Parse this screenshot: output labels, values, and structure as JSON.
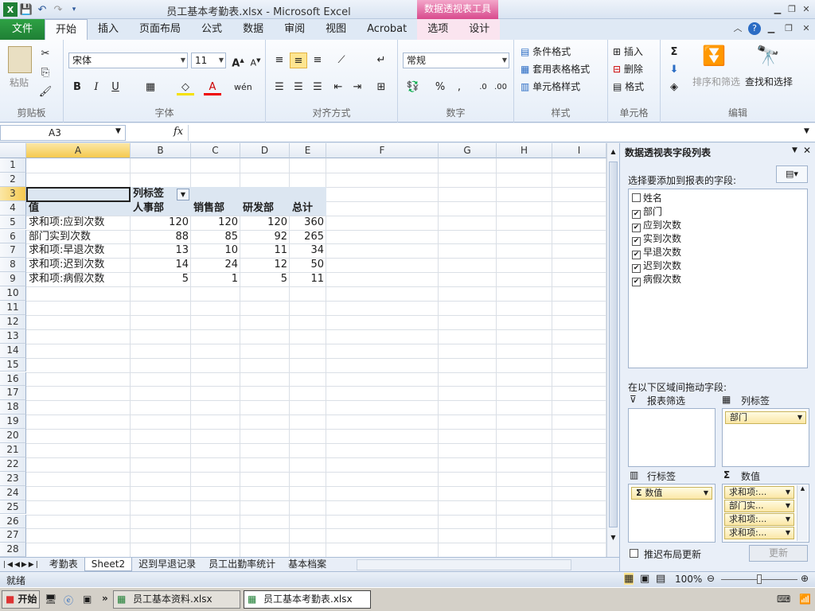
{
  "window": {
    "title": "员工基本考勤表.xlsx - Microsoft Excel",
    "pivot_tools": "数据透视表工具"
  },
  "tabs": [
    "文件",
    "开始",
    "插入",
    "页面布局",
    "公式",
    "数据",
    "审阅",
    "视图",
    "Acrobat",
    "选项",
    "设计"
  ],
  "ribbon": {
    "clipboard": {
      "paste": "粘贴",
      "label": "剪贴板"
    },
    "font": {
      "name": "宋体",
      "size": "11",
      "label": "字体"
    },
    "align": {
      "label": "对齐方式"
    },
    "number": {
      "format": "常规",
      "label": "数字"
    },
    "styles": {
      "cond": "条件格式",
      "table": "套用表格格式",
      "cell": "单元格样式",
      "label": "样式"
    },
    "cells": {
      "insert": "插入",
      "delete": "删除",
      "format": "格式",
      "label": "单元格"
    },
    "edit": {
      "sort": "排序和筛选",
      "find": "查找和选择",
      "label": "编辑"
    }
  },
  "formula": {
    "namebox": "A3",
    "fx": "fx"
  },
  "columns": [
    "A",
    "B",
    "C",
    "D",
    "E",
    "F",
    "G",
    "H",
    "I"
  ],
  "pivot": {
    "col_label": "列标签",
    "value_hdr": "值",
    "headers": [
      "人事部",
      "销售部",
      "研发部",
      "总计"
    ],
    "rows": [
      {
        "label": "求和项:应到次数",
        "values": [
          "120",
          "120",
          "120",
          "360"
        ]
      },
      {
        "label": "部门实到次数",
        "values": [
          "88",
          "85",
          "92",
          "265"
        ]
      },
      {
        "label": "求和项:早退次数",
        "values": [
          "13",
          "10",
          "11",
          "34"
        ]
      },
      {
        "label": "求和项:迟到次数",
        "values": [
          "14",
          "24",
          "12",
          "50"
        ]
      },
      {
        "label": "求和项:病假次数",
        "values": [
          "5",
          "1",
          "5",
          "11"
        ]
      }
    ]
  },
  "sheets": [
    "考勤表",
    "Sheet2",
    "迟到早退记录",
    "员工出勤率统计",
    "基本档案"
  ],
  "status": {
    "ready": "就绪",
    "zoom": "100%"
  },
  "pane": {
    "title": "数据透视表字段列表",
    "choose": "选择要添加到报表的字段:",
    "fields": [
      {
        "name": "姓名",
        "checked": false
      },
      {
        "name": "部门",
        "checked": true
      },
      {
        "name": "应到次数",
        "checked": true
      },
      {
        "name": "实到次数",
        "checked": true
      },
      {
        "name": "早退次数",
        "checked": true
      },
      {
        "name": "迟到次数",
        "checked": true
      },
      {
        "name": "病假次数",
        "checked": true
      }
    ],
    "drag": "在以下区域间拖动字段:",
    "filter": "报表筛选",
    "col": "列标签",
    "row": "行标签",
    "values": "数值",
    "col_field": "部门",
    "row_field": "数值",
    "value_fields": [
      "求和项:...",
      "部门实...",
      "求和项:...",
      "求和项:..."
    ],
    "defer": "推迟布局更新",
    "update": "更新"
  },
  "taskbar": {
    "start": "开始",
    "tasks": [
      "员工基本资料.xlsx",
      "员工基本考勤表.xlsx"
    ],
    "more": "»"
  }
}
